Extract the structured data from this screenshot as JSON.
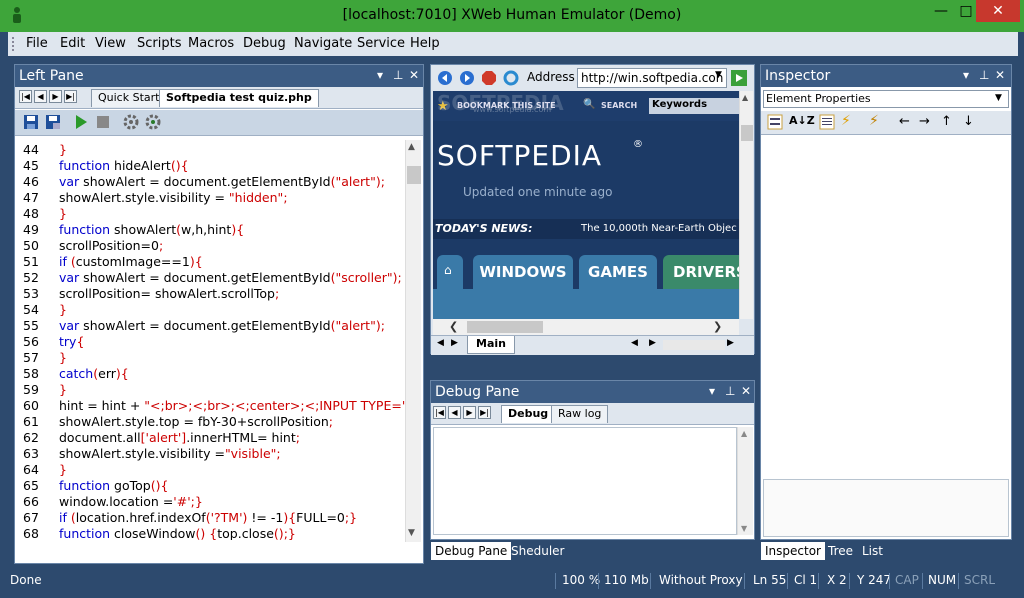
{
  "window": {
    "title": "[localhost:7010] XWeb Human Emulator (Demo)",
    "minimize": "—",
    "maximize": "□",
    "close": "✕"
  },
  "menu": [
    "File",
    "Edit",
    "View",
    "Scripts",
    "Macros",
    "Debug",
    "Navigate",
    "Service",
    "Help"
  ],
  "left_pane": {
    "title": "Left Pane",
    "tabs": [
      {
        "label": "Quick Start"
      },
      {
        "label": "Softpedia test quiz.php"
      }
    ],
    "code": [
      {
        "n": "44",
        "t": "}"
      },
      {
        "n": "45",
        "t": "function hideAlert(){"
      },
      {
        "n": "46",
        "t": "var showAlert = document.getElementById(\"alert\");"
      },
      {
        "n": "47",
        "t": "showAlert.style.visibility = \"hidden\";"
      },
      {
        "n": "48",
        "t": "}"
      },
      {
        "n": "49",
        "t": "function showAlert(w,h,hint){"
      },
      {
        "n": "50",
        "t": "scrollPosition=0;"
      },
      {
        "n": "51",
        "t": "if (customImage==1){"
      },
      {
        "n": "52",
        "t": "var showAlert = document.getElementById(\"scroller\");"
      },
      {
        "n": "53",
        "t": "scrollPosition= showAlert.scrollTop;"
      },
      {
        "n": "54",
        "t": "}"
      },
      {
        "n": "55",
        "t": "var showAlert = document.getElementById(\"alert\");"
      },
      {
        "n": "56",
        "t": "try{"
      },
      {
        "n": "57",
        "t": "}"
      },
      {
        "n": "58",
        "t": "catch(err){"
      },
      {
        "n": "59",
        "t": "}"
      },
      {
        "n": "60",
        "t": "hint = hint + \"<br><br><center><INPUT TYPE='BUTTON' V"
      },
      {
        "n": "61",
        "t": "showAlert.style.top = fbY-30+scrollPosition;"
      },
      {
        "n": "62",
        "t": "document.all['alert'].innerHTML= hint;"
      },
      {
        "n": "63",
        "t": "showAlert.style.visibility =\"visible\";"
      },
      {
        "n": "64",
        "t": "}"
      },
      {
        "n": "65",
        "t": "function goTop(){"
      },
      {
        "n": "66",
        "t": "window.location ='#';}"
      },
      {
        "n": "67",
        "t": "if (location.href.indexOf('?TM') != -1){FULL=0;}"
      },
      {
        "n": "68",
        "t": "function closeWindow() {top.close();}"
      }
    ]
  },
  "browser": {
    "address_label": "Address",
    "address_value": "http://win.softpedia.con",
    "watermark": "SOFTPEDIA",
    "watermark_sub": "www.softpedia.com",
    "bookmark": "BOOKMARK THIS SITE",
    "search": "SEARCH",
    "keywords": "Keywords",
    "logo": "SOFTPEDIA",
    "logo_mark": "®",
    "updated": "Updated one minute ago",
    "news_label": "TODAY'S NEWS:",
    "news_text": "The 10,000th Near-Earth Objec",
    "nav_tabs": [
      "WINDOWS",
      "GAMES",
      "DRIVERS"
    ],
    "tab": "Main"
  },
  "debug_pane": {
    "title": "Debug Pane",
    "tabs": [
      "Debug",
      "Raw log"
    ]
  },
  "mid_bottom_tabs": [
    "Debug Pane",
    "Sheduler"
  ],
  "inspector": {
    "title": "Inspector",
    "dropdown": "Element Properties",
    "bottom_tabs": [
      "Inspector",
      "Tree",
      "List"
    ]
  },
  "status": {
    "left": "Done",
    "zoom": "100 %",
    "mem": "110 Mb",
    "proxy": "Without Proxy",
    "ln": "Ln 55",
    "cl": "Cl 1",
    "x": "X 2",
    "y": "Y 247",
    "cap": "CAP",
    "num": "NUM",
    "scrl": "SCRL"
  }
}
